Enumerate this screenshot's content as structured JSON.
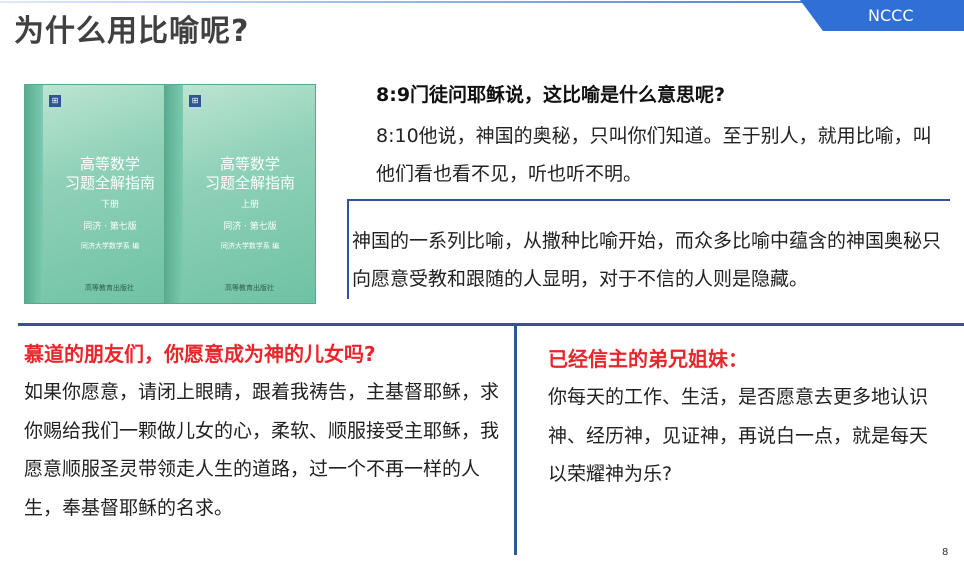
{
  "header": {
    "title": "为什么用比喻呢?",
    "badge": "NCCC"
  },
  "books": [
    {
      "cover_title_line1": "高等数学",
      "cover_title_line2": "习题全解指南",
      "volume": "下册",
      "edition": "同济 · 第七版",
      "author": "同济大学数学系 编",
      "press": "高等教育出版社"
    },
    {
      "cover_title_line1": "高等数学",
      "cover_title_line2": "习题全解指南",
      "volume": "上册",
      "edition": "同济 · 第七版",
      "author": "同济大学数学系 编",
      "press": "高等教育出版社"
    }
  ],
  "scripture": {
    "question": "8:9门徒问耶稣说，这比喻是什么意思呢?",
    "answer": "8:10他说，神国的奥秘，只叫你们知道。至于别人，就用比喻，叫他们看也看不见，听也听不明。"
  },
  "explanation": "神国的一系列比喻，从撒种比喻开始，而众多比喻中蕴含的神国奥秘只向愿意受教和跟随的人显明，对于不信的人则是隐藏。",
  "left_panel": {
    "heading": "慕道的朋友们，你愿意成为神的儿女吗?",
    "body": "如果你愿意，请闭上眼睛，跟着我祷告，主基督耶稣，求你赐给我们一颗做儿女的心，柔软、顺服接受主耶稣，我愿意顺服圣灵带领走人生的道路，过一个不再一样的人生，奉基督耶稣的名求。"
  },
  "right_panel": {
    "heading": "已经信主的弟兄姐妹：",
    "body": "你每天的工作、生活，是否愿意去更多地认识神、经历神，见证神，再说白一点，就是每天以荣耀神为乐?"
  },
  "page_number": "8",
  "colors": {
    "accent_blue": "#2f6fd6",
    "divider_blue": "#2f5597",
    "heading_red": "#e8262b",
    "title_gray": "#404040"
  }
}
